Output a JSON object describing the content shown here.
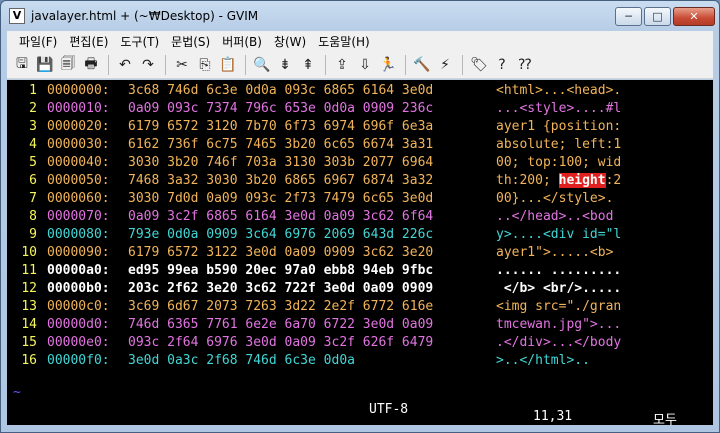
{
  "window": {
    "title": "javalayer.html + (~₩Desktop) - GVIM",
    "app_icon": "vim-icon",
    "minimize": "─",
    "maximize": "□",
    "close": "✕"
  },
  "menu": [
    "파일(F)",
    "편집(E)",
    "도구(T)",
    "문법(S)",
    "버퍼(B)",
    "창(W)",
    "도움말(H)"
  ],
  "toolbar": {
    "icons": [
      "open-icon",
      "save-icon",
      "save-all-icon",
      "print-icon",
      "undo-icon",
      "redo-icon",
      "cut-icon",
      "copy-icon",
      "paste-icon",
      "find-replace-icon",
      "find-next-icon",
      "find-prev-icon",
      "load-session-icon",
      "save-session-icon",
      "run-script-icon",
      "make-icon",
      "shell-icon",
      "tags-icon",
      "help-icon",
      "find-help-icon"
    ],
    "glyphs": [
      "🖫",
      "💾",
      "🗐",
      "🖶",
      "↶",
      "↷",
      "✂",
      "⎘",
      "📋",
      "🔍",
      "⇟",
      "⇞",
      "⇪",
      "⇩",
      "🏃",
      "🔨",
      "⚡",
      "🏷",
      "?",
      "⁇"
    ]
  },
  "lines": [
    {
      "n": "1",
      "addr": "0000000:",
      "hex": "3c68 746d 6c3e 0d0a 093c 6865 6164 3e0d",
      "asc": "<html>...<head>.",
      "cls": "c-ora"
    },
    {
      "n": "2",
      "addr": "0000010:",
      "hex": "0a09 093c 7374 796c 653e 0d0a 0909 236c",
      "asc": "...<style>....#l",
      "cls": "c-mag"
    },
    {
      "n": "3",
      "addr": "0000020:",
      "hex": "6179 6572 3120 7b70 6f73 6974 696f 6e3a",
      "asc": "ayer1 {position:",
      "cls": "c-ora"
    },
    {
      "n": "4",
      "addr": "0000030:",
      "hex": "6162 736f 6c75 7465 3b20 6c65 6674 3a31",
      "asc": "absolute; left:1",
      "cls": "c-ora"
    },
    {
      "n": "5",
      "addr": "0000040:",
      "hex": "3030 3b20 746f 703a 3130 303b 2077 6964",
      "asc": "00; top:100; wid",
      "cls": "c-ora"
    },
    {
      "n": "6",
      "addr": "0000050:",
      "hex": "7468 3a32 3030 3b20 6865 6967 6874 3a32",
      "asc_pre": "th:200; ",
      "asc_hl": "height",
      "asc_post": ":2",
      "cls": "c-ora"
    },
    {
      "n": "7",
      "addr": "0000060:",
      "hex": "3030 7d0d 0a09 093c 2f73 7479 6c65 3e0d",
      "asc": "00}...</style>.",
      "cls": "c-ora"
    },
    {
      "n": "8",
      "addr": "0000070:",
      "hex": "0a09 3c2f 6865 6164 3e0d 0a09 3c62 6f64",
      "asc": "..</head>..<bod",
      "cls": "c-mag"
    },
    {
      "n": "9",
      "addr": "0000080:",
      "hex": "793e 0d0a 0909 3c64 6976 2069 643d 226c",
      "asc": "y>....<div id=\"l",
      "cls": "c-cyan"
    },
    {
      "n": "10",
      "addr": "0000090:",
      "hex": "6179 6572 3122 3e0d 0a09 0909 3c62 3e20",
      "asc": "ayer1\">.....<b>",
      "cls": "c-ora"
    },
    {
      "n": "11",
      "addr": "00000a0:",
      "hex": "ed95 99ea b590 20ec 97a0 ebb8 94eb 9fbc",
      "asc": "...... .........",
      "cls": "c-wht"
    },
    {
      "n": "12",
      "addr": "00000b0:",
      "hex": "203c 2f62 3e20 3c62 722f 3e0d 0a09 0909",
      "asc": " </b> <br/>.....",
      "cls": "c-wht"
    },
    {
      "n": "13",
      "addr": "00000c0:",
      "hex": "3c69 6d67 2073 7263 3d22 2e2f 6772 616e",
      "asc": "<img src=\"./gran",
      "cls": "c-ora"
    },
    {
      "n": "14",
      "addr": "00000d0:",
      "hex": "746d 6365 7761 6e2e 6a70 6722 3e0d 0a09",
      "asc": "tmcewan.jpg\">...",
      "cls": "c-mag"
    },
    {
      "n": "15",
      "addr": "00000e0:",
      "hex": "093c 2f64 6976 3e0d 0a09 3c2f 626f 6479",
      "asc": ".</div>...</body",
      "cls": "c-mag"
    },
    {
      "n": "16",
      "addr": "00000f0:",
      "hex": "3e0d 0a3c 2f68 746d 6c3e 0d0a",
      "asc": ">..</html>..",
      "cls": "c-cyan"
    }
  ],
  "status": {
    "encoding": "UTF-8",
    "cursor": "11,31",
    "scroll": "모두"
  },
  "tilde": "~"
}
